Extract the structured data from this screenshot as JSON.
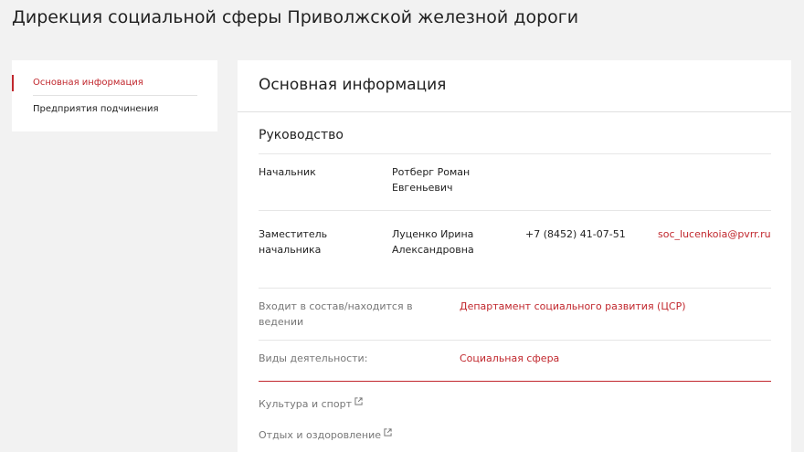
{
  "page": {
    "title": "Дирекция социальной сферы Приволжской железной дороги"
  },
  "sidebar": {
    "items": [
      {
        "label": "Основная информация"
      },
      {
        "label": "Предприятия подчинения"
      }
    ]
  },
  "main": {
    "header_title": "Основная информация",
    "leadership": {
      "title": "Руководство",
      "rows": [
        {
          "position_line1": "Начальник",
          "position_line2": "",
          "name_line1": "Ротберг Роман",
          "name_line2": "Евгеньевич",
          "phone": "",
          "email": ""
        },
        {
          "position_line1": "Заместитель",
          "position_line2": "начальника",
          "name_line1": "Луценко Ирина",
          "name_line2": "Александровна",
          "phone": "+7 (8452) 41-07-51",
          "email": "soc_lucenkoia@pvrr.ru"
        }
      ]
    },
    "membership": {
      "label_line1": "Входит в состав/находится в",
      "label_line2": "ведении",
      "value": "Департамент социального развития (ЦСР)"
    },
    "activities": {
      "label": "Виды деятельности:",
      "value": "Социальная сфера",
      "links": [
        {
          "label": "Культура и спорт",
          "icon": "external-link-icon"
        },
        {
          "label": "Отдых и оздоровление",
          "icon": "external-link-icon"
        }
      ]
    }
  },
  "colors": {
    "accent": "#c1272d",
    "background": "#f2f2f2",
    "card": "#ffffff"
  }
}
